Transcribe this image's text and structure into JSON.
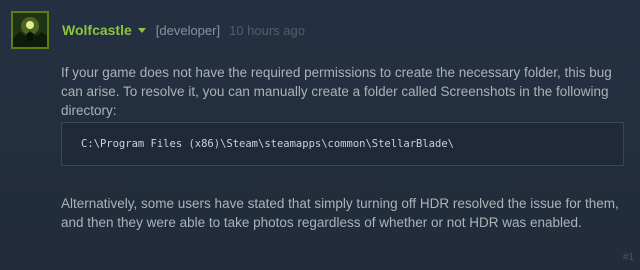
{
  "comment": {
    "author": "Wolfcastle",
    "role": "[developer]",
    "timestamp": "10 hours ago",
    "paragraph_1": "If your game does not have the required permissions to create the necessary folder, this bug can arise. To resolve it, you can manually create a folder called Screenshots in the following directory:",
    "code": "C:\\Program Files (x86)\\Steam\\steamapps\\common\\StellarBlade\\",
    "paragraph_2": "Alternatively, some users have stated that simply turning off HDR resolved the issue for them, and then they were able to take photos regardless of whether or not HDR was enabled.",
    "post_number": "#1"
  },
  "colors": {
    "background": "#222d3b",
    "author": "#8bc53f",
    "body_text": "#acb2b8",
    "timestamp": "#565e66",
    "code_background": "#1f2937"
  },
  "icons": {
    "author_menu": "chevron-down-icon"
  }
}
